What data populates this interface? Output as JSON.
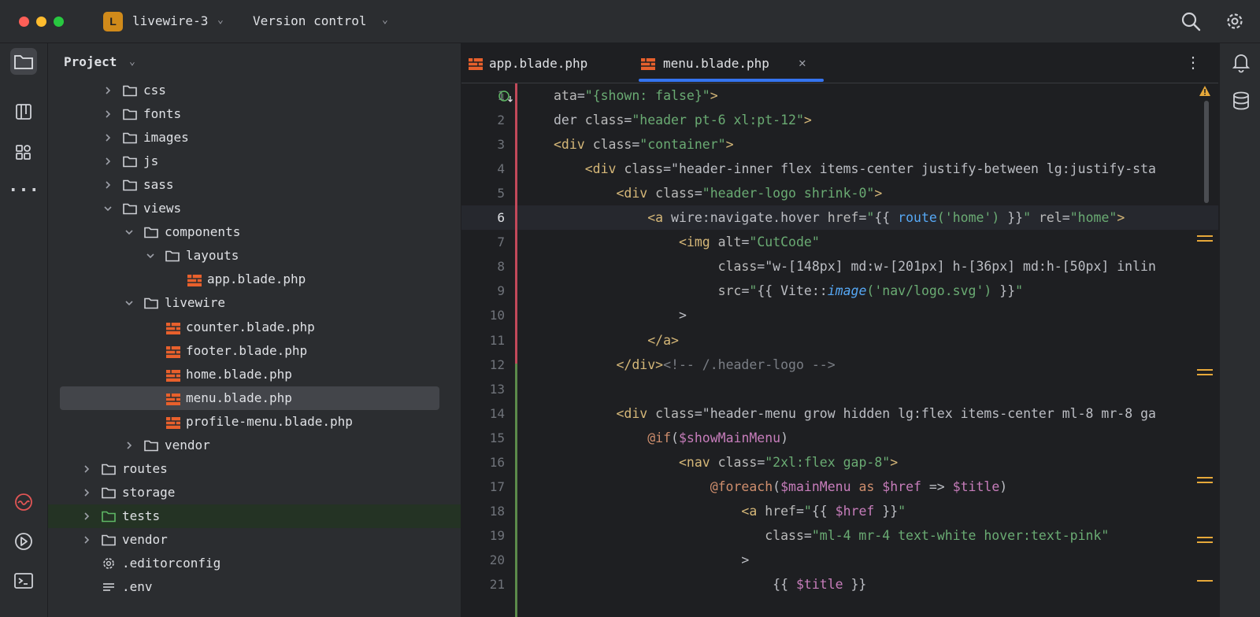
{
  "titlebar": {
    "project_badge": "L",
    "project_name": "livewire-3",
    "vcs_label": "Version control"
  },
  "left_toolbar": {
    "icons": [
      "folder-icon",
      "structure-icon",
      "plugins-icon",
      "more-icon",
      "laravel-icon",
      "run-icon",
      "terminal-icon"
    ]
  },
  "right_toolbar": {
    "icons": [
      "notifications-icon",
      "database-icon"
    ]
  },
  "project_panel": {
    "title": "Project",
    "tree": [
      {
        "label": "css",
        "type": "folder",
        "depth": 2,
        "expanded": false
      },
      {
        "label": "fonts",
        "type": "folder",
        "depth": 2,
        "expanded": false
      },
      {
        "label": "images",
        "type": "folder",
        "depth": 2,
        "expanded": false
      },
      {
        "label": "js",
        "type": "folder",
        "depth": 2,
        "expanded": false
      },
      {
        "label": "sass",
        "type": "folder",
        "depth": 2,
        "expanded": false
      },
      {
        "label": "views",
        "type": "folder",
        "depth": 2,
        "expanded": true
      },
      {
        "label": "components",
        "type": "folder",
        "depth": 3,
        "expanded": true
      },
      {
        "label": "layouts",
        "type": "folder",
        "depth": 4,
        "expanded": true
      },
      {
        "label": "app.blade.php",
        "type": "blade",
        "depth": 5
      },
      {
        "label": "livewire",
        "type": "folder",
        "depth": 3,
        "expanded": true
      },
      {
        "label": "counter.blade.php",
        "type": "blade",
        "depth": 4
      },
      {
        "label": "footer.blade.php",
        "type": "blade",
        "depth": 4
      },
      {
        "label": "home.blade.php",
        "type": "blade",
        "depth": 4
      },
      {
        "label": "menu.blade.php",
        "type": "blade",
        "depth": 4,
        "selected": true
      },
      {
        "label": "profile-menu.blade.php",
        "type": "blade",
        "depth": 4
      },
      {
        "label": "vendor",
        "type": "folder",
        "depth": 3,
        "expanded": false
      },
      {
        "label": "routes",
        "type": "folder",
        "depth": 1,
        "expanded": false
      },
      {
        "label": "storage",
        "type": "folder",
        "depth": 1,
        "expanded": false
      },
      {
        "label": "tests",
        "type": "folder-green",
        "depth": 1,
        "expanded": false
      },
      {
        "label": "vendor",
        "type": "folder",
        "depth": 1,
        "expanded": false
      },
      {
        "label": ".editorconfig",
        "type": "config",
        "depth": 1
      },
      {
        "label": ".env",
        "type": "env",
        "depth": 1
      }
    ]
  },
  "editor": {
    "tabs": [
      {
        "label": "app.blade.php",
        "active": false
      },
      {
        "label": "menu.blade.php",
        "active": true
      }
    ],
    "current_line": 6,
    "lines": [
      {
        "n": "1",
        "code": "ata=\"{shown: false}\">"
      },
      {
        "n": "2",
        "code": "der class=\"header pt-6 xl:pt-12\">"
      },
      {
        "n": "3",
        "code": "<div class=\"container\">"
      },
      {
        "n": "4",
        "code": "    <div class=\"header-inner flex items-center justify-between lg:justify-sta"
      },
      {
        "n": "5",
        "code": "        <div class=\"header-logo shrink-0\">"
      },
      {
        "n": "6",
        "code": "            <a wire:navigate.hover href=\"{{ route('home') }}\" rel=\"home\">"
      },
      {
        "n": "7",
        "code": "                <img alt=\"CutCode\""
      },
      {
        "n": "8",
        "code": "                     class=\"w-[148px] md:w-[201px] h-[36px] md:h-[50px] inlin"
      },
      {
        "n": "9",
        "code": "                     src=\"{{ Vite::image('nav/logo.svg') }}\""
      },
      {
        "n": "10",
        "code": "                >"
      },
      {
        "n": "11",
        "code": "            </a>"
      },
      {
        "n": "12",
        "code": "        </div><!-- /.header-logo -->"
      },
      {
        "n": "13",
        "code": ""
      },
      {
        "n": "14",
        "code": "        <div class=\"header-menu grow hidden lg:flex items-center ml-8 mr-8 ga"
      },
      {
        "n": "15",
        "code": "            @if($showMainMenu)"
      },
      {
        "n": "16",
        "code": "                <nav class=\"2xl:flex gap-8\">"
      },
      {
        "n": "17",
        "code": "                    @foreach($mainMenu as $href => $title)"
      },
      {
        "n": "18",
        "code": "                        <a href=\"{{ $href }}\""
      },
      {
        "n": "19",
        "code": "                           class=\"ml-4 mr-4 text-white hover:text-pink\""
      },
      {
        "n": "20",
        "code": "                        >"
      },
      {
        "n": "21",
        "code": "                            {{ $title }}"
      }
    ]
  },
  "colors": {
    "accent": "#3574f0",
    "background": "#1e1f22",
    "panel": "#2b2d30",
    "blade_icon": "#e8602c",
    "string": "#6aab73",
    "tag": "#d5b778"
  }
}
